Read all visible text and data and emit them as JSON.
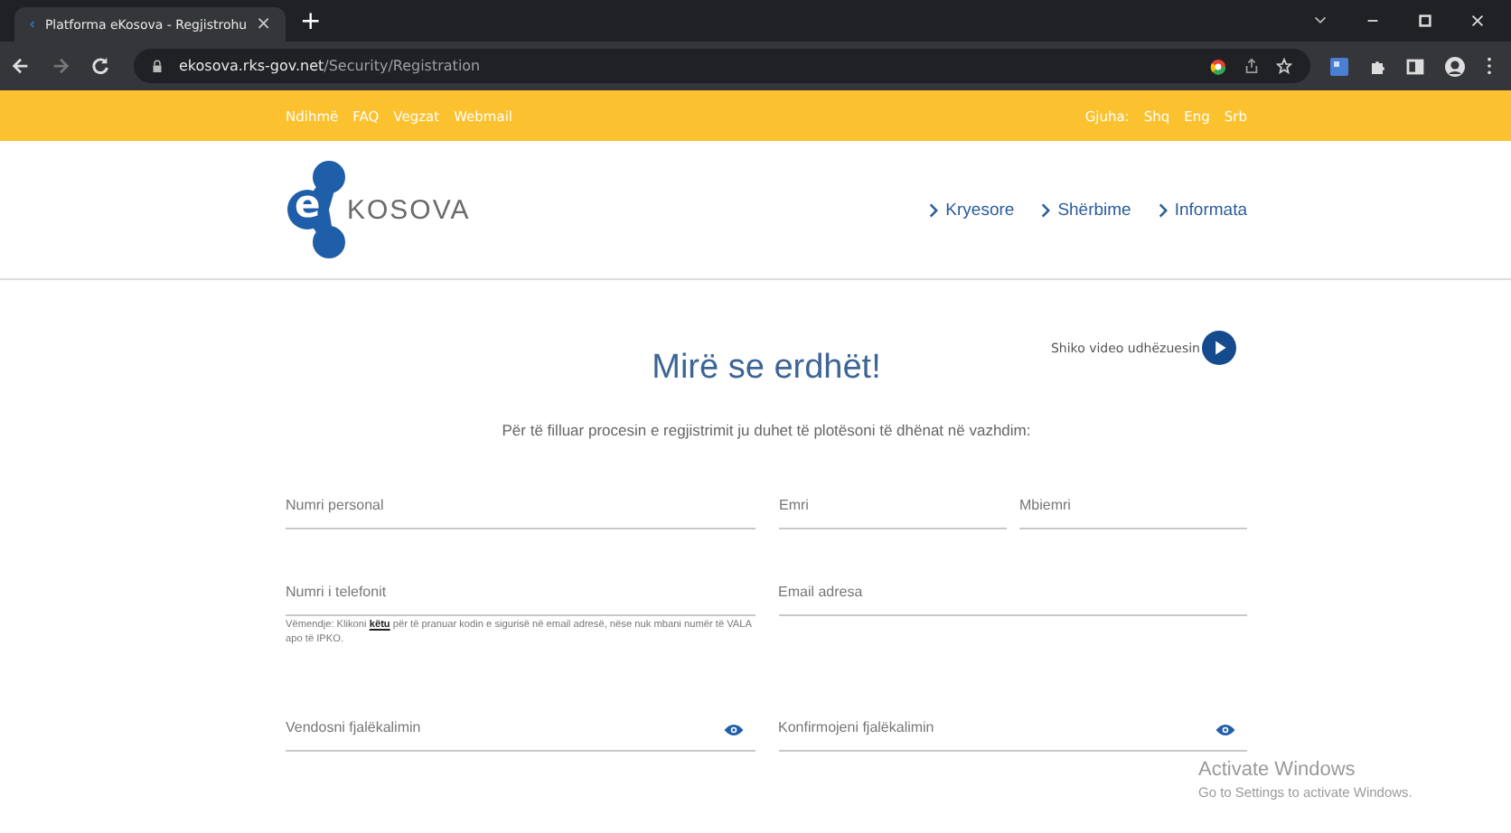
{
  "browser": {
    "tab_title": "Platforma eKosova - Regjistrohu",
    "close": "×",
    "new_tab": "+",
    "url_host": "ekosova.rks-gov.net",
    "url_path": "/Security/Registration"
  },
  "topbar": {
    "links": [
      "Ndihmë",
      "FAQ",
      "Vegzat",
      "Webmail"
    ],
    "language_label": "Gjuha:",
    "languages": [
      "Shq",
      "Eng",
      "Srb"
    ]
  },
  "header": {
    "logo_letter": "e",
    "logo_text": "KOSOVA",
    "nav": [
      "Kryesore",
      "Shërbime",
      "Informata"
    ]
  },
  "title": "Mirë se erdhët!",
  "video_link": "Shiko video udhëzuesin",
  "intro": "Për të filluar procesin e regjistrimit ju duhet të plotësoni të dhënat në vazhdim:",
  "rows": [
    {
      "fields": [
        {
          "kind": "text",
          "placeholder": "Numri personal"
        },
        {
          "kind": "text",
          "placeholder": "Emri"
        },
        {
          "kind": "text",
          "placeholder": "Mbiemri"
        }
      ]
    },
    {
      "fields": [
        {
          "kind": "text",
          "placeholder": "Numri i telefonit",
          "hint": {
            "before": "Vëmendje: Klikoni",
            "link": "këtu",
            "after": "për të pranuar kodin e sigurisë në email adresë, nëse nuk mbani numër të VALA apo të IPKO."
          }
        },
        {
          "kind": "text",
          "placeholder": "Email adresa"
        }
      ]
    },
    {
      "fields": [
        {
          "kind": "password",
          "placeholder": "Vendosni fjalëkalimin"
        },
        {
          "kind": "password",
          "placeholder": "Konfirmojeni fjalëkalimin"
        }
      ]
    }
  ],
  "os_notice": {
    "title": "Activate Windows",
    "text": "Go to Settings to activate Windows."
  }
}
